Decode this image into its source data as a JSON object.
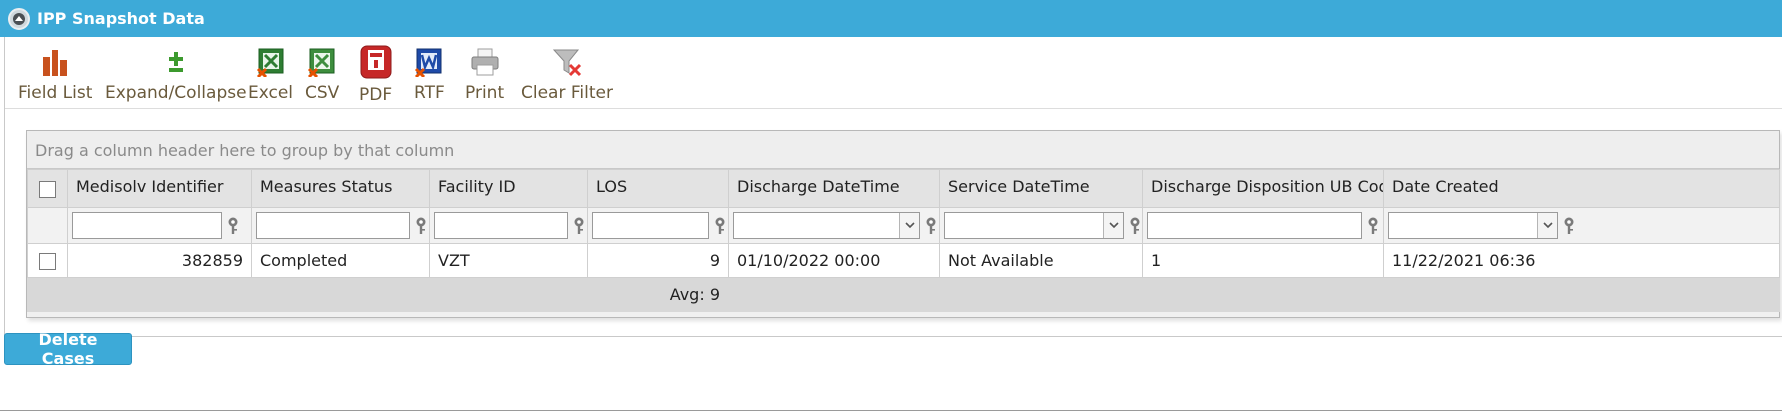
{
  "panel": {
    "title": "IPP Snapshot Data"
  },
  "toolbar": {
    "items": [
      {
        "label": "Field List",
        "icon": "field-list-icon"
      },
      {
        "label": "Expand/Collapse",
        "icon": "expand-collapse-icon"
      },
      {
        "label": "Excel",
        "icon": "excel-icon"
      },
      {
        "label": "CSV",
        "icon": "csv-icon"
      },
      {
        "label": "PDF",
        "icon": "pdf-icon"
      },
      {
        "label": "RTF",
        "icon": "rtf-icon"
      },
      {
        "label": "Print",
        "icon": "print-icon"
      },
      {
        "label": "Clear Filter",
        "icon": "clear-filter-icon"
      }
    ]
  },
  "grid": {
    "group_panel_text": "Drag a column header here to group by that column",
    "columns": [
      "Medisolv Identifier",
      "Measures Status",
      "Facility ID",
      "LOS",
      "Discharge DateTime",
      "Service DateTime",
      "Discharge Disposition UB Code",
      "Date Created"
    ],
    "rows": [
      {
        "medisolv_identifier": "382859",
        "measures_status": "Completed",
        "facility_id": "VZT",
        "los": "9",
        "discharge_datetime": "01/10/2022 00:00",
        "service_datetime": "Not Available",
        "discharge_disposition_ub_code": "1",
        "date_created": "11/22/2021 06:36"
      }
    ],
    "footer": {
      "los_avg": "Avg: 9"
    }
  },
  "actions": {
    "delete_label": "Delete Cases"
  },
  "colors": {
    "accent": "#3daad8"
  }
}
